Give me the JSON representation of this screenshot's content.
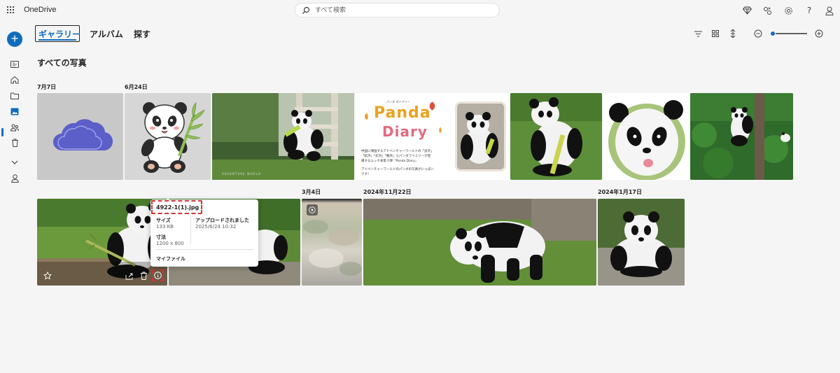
{
  "app": {
    "title": "OneDrive"
  },
  "search": {
    "placeholder": "すべて検索"
  },
  "header_icons": [
    "premium-diamond-icon",
    "shared-icon",
    "settings-gear-icon",
    "help-icon",
    "account-person-icon"
  ],
  "help_glyph": "?",
  "rail": {
    "new_button": "+",
    "items": [
      "home-icon",
      "my-files-icon",
      "photos-icon",
      "people-icon",
      "recycle-bin-icon"
    ]
  },
  "tabs": [
    {
      "label": "ギャラリー",
      "active": true
    },
    {
      "label": "アルバム",
      "active": false
    },
    {
      "label": "探す",
      "active": false
    }
  ],
  "page_title": "すべての写真",
  "dates": {
    "d1": "7月7日",
    "d2": "6月24日",
    "d3": "3月4日",
    "d4": "2024年11月22日",
    "d5": "2024年1月17日"
  },
  "zoom": {
    "level": 0.05
  },
  "photos": {
    "poster": {
      "kana": "パンダ ダイアリー",
      "title1": "Panda",
      "title2": "Diary",
      "line1": "中国に帰国するアドベンチャーワールドの「良浜」",
      "line2": "「結浜」「彩浜」「楓浜」らパンダファミリーが登",
      "line3": "場するムック本第３弾「Panda Diary」",
      "line4": "アドベンチャーワールドのパンダの写真がいっぱい",
      "line5": "です！"
    },
    "watermark": "ADVENTURE WORLD"
  },
  "tooltip": {
    "filename": "4922-1(1).jpg",
    "size_label": "サイズ",
    "size_value": "133 KB",
    "uploaded_label": "アップロードされました",
    "uploaded_value": "2025/6/24 10:32",
    "dimensions_label": "寸法",
    "dimensions_value": "1200 x 800",
    "location": "マイファイル"
  },
  "colors": {
    "accent": "#0f6cbd",
    "highlight": "#d13438"
  }
}
